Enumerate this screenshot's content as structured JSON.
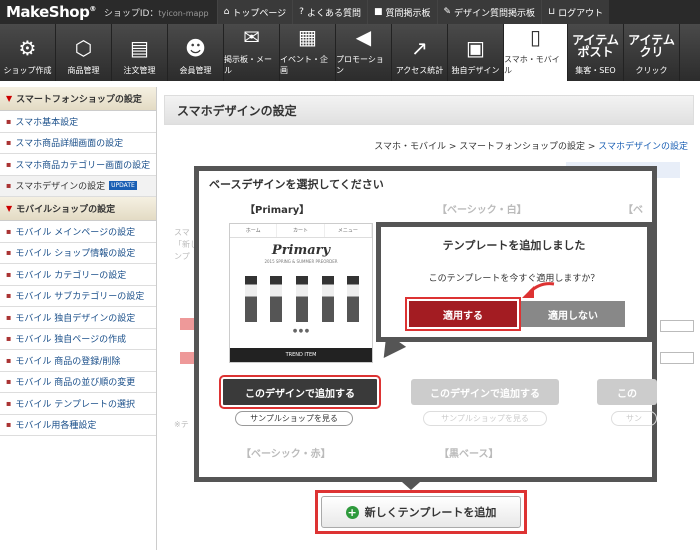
{
  "top": {
    "logo": "MakeShop",
    "logo_mark": "®",
    "shopid_label": "ショップID：",
    "shopid_value": "tyicon-mapp",
    "links": [
      {
        "icon": "home-icon",
        "glyph": "⌂",
        "label": "トップページ"
      },
      {
        "icon": "question-icon",
        "glyph": "?",
        "label": "よくある質問"
      },
      {
        "icon": "board-icon",
        "glyph": "■",
        "label": "質問掲示板"
      },
      {
        "icon": "design-board-icon",
        "glyph": "✎",
        "label": "デザイン質問掲示板"
      },
      {
        "icon": "unlock-icon",
        "glyph": "⊔",
        "label": "ログアウト"
      }
    ]
  },
  "nav": [
    {
      "label": "ショップ作成",
      "icon": "gears-icon",
      "glyph": "⚙"
    },
    {
      "label": "商品管理",
      "icon": "box-icon",
      "glyph": "⬡"
    },
    {
      "label": "注文管理",
      "icon": "clipboard-icon",
      "glyph": "▤"
    },
    {
      "label": "会員管理",
      "icon": "users-icon",
      "glyph": "☻"
    },
    {
      "label": "掲示板・メール",
      "icon": "mail-icon",
      "glyph": "✉"
    },
    {
      "label": "イベント・企画",
      "icon": "calendar-icon",
      "glyph": "▦"
    },
    {
      "label": "プロモーション",
      "icon": "megaphone-icon",
      "glyph": "◀"
    },
    {
      "label": "アクセス統計",
      "icon": "chart-icon",
      "glyph": "↗"
    },
    {
      "label": "独自デザイン",
      "icon": "image-icon",
      "glyph": "▣"
    },
    {
      "label": "スマホ・モバイル",
      "icon": "phone-icon",
      "glyph": "▯"
    },
    {
      "label": "集客・SEO",
      "icon": "item-post-icon",
      "glyph": "アイテム ポスト"
    },
    {
      "label": "クリック",
      "icon": "item-click-icon",
      "glyph": "アイテム クリ"
    }
  ],
  "sidebar": {
    "section1": "スマートフォンショップの設定",
    "items1": [
      "スマホ基本設定",
      "スマホ商品詳細画面の設定",
      "スマホ商品カテゴリー画面の設定",
      "スマホデザインの設定"
    ],
    "update_badge": "UPDATE",
    "section2": "モバイルショップの設定",
    "items2": [
      "モバイル メインページの設定",
      "モバイル ショップ情報の設定",
      "モバイル カテゴリーの設定",
      "モバイル サブカテゴリーの設定",
      "モバイル 独自デザインの設定",
      "モバイル 独自ページの作成",
      "モバイル 商品の登録/削除",
      "モバイル 商品の並び順の変更",
      "モバイル テンプレートの選択",
      "モバイル用各種設定"
    ]
  },
  "main": {
    "title": "スマホデザインの設定",
    "breadcrumb": [
      "スマホ・モバイル",
      "スマートフォンショップの設定",
      "スマホデザインの設定"
    ],
    "bg_text": [
      "スマ",
      "「新し",
      "ンプ"
    ],
    "bg_footer": "※テ"
  },
  "overlay": {
    "title": "ベースデザインを選択してください",
    "templates": [
      "【Primary】",
      "【ベーシック・白】",
      "【ベ"
    ],
    "templates_row2": [
      "【ベーシック・赤】",
      "【黒ベース】"
    ],
    "preview": {
      "nav": [
        "ホーム",
        "カート",
        "メニュー"
      ],
      "logo": "Primary",
      "sub": "2015 SPRING & SUMMER PREORDER",
      "dots": "● ● ●",
      "bar": "TREND ITEM"
    },
    "add_button": "このデザインで追加する",
    "sample_button": "サンプルショップを見る"
  },
  "dialog": {
    "title": "テンプレートを追加しました",
    "message": "このテンプレートを今すぐ適用しますか？",
    "apply": "適用する",
    "no_apply": "適用しない"
  },
  "new_template_button": "新しくテンプレートを追加",
  "colors": {
    "accent_red": "#d33333",
    "apply_red": "#a31c22",
    "plus_green": "#2e9a3c",
    "link_blue": "#1a4f8a"
  }
}
